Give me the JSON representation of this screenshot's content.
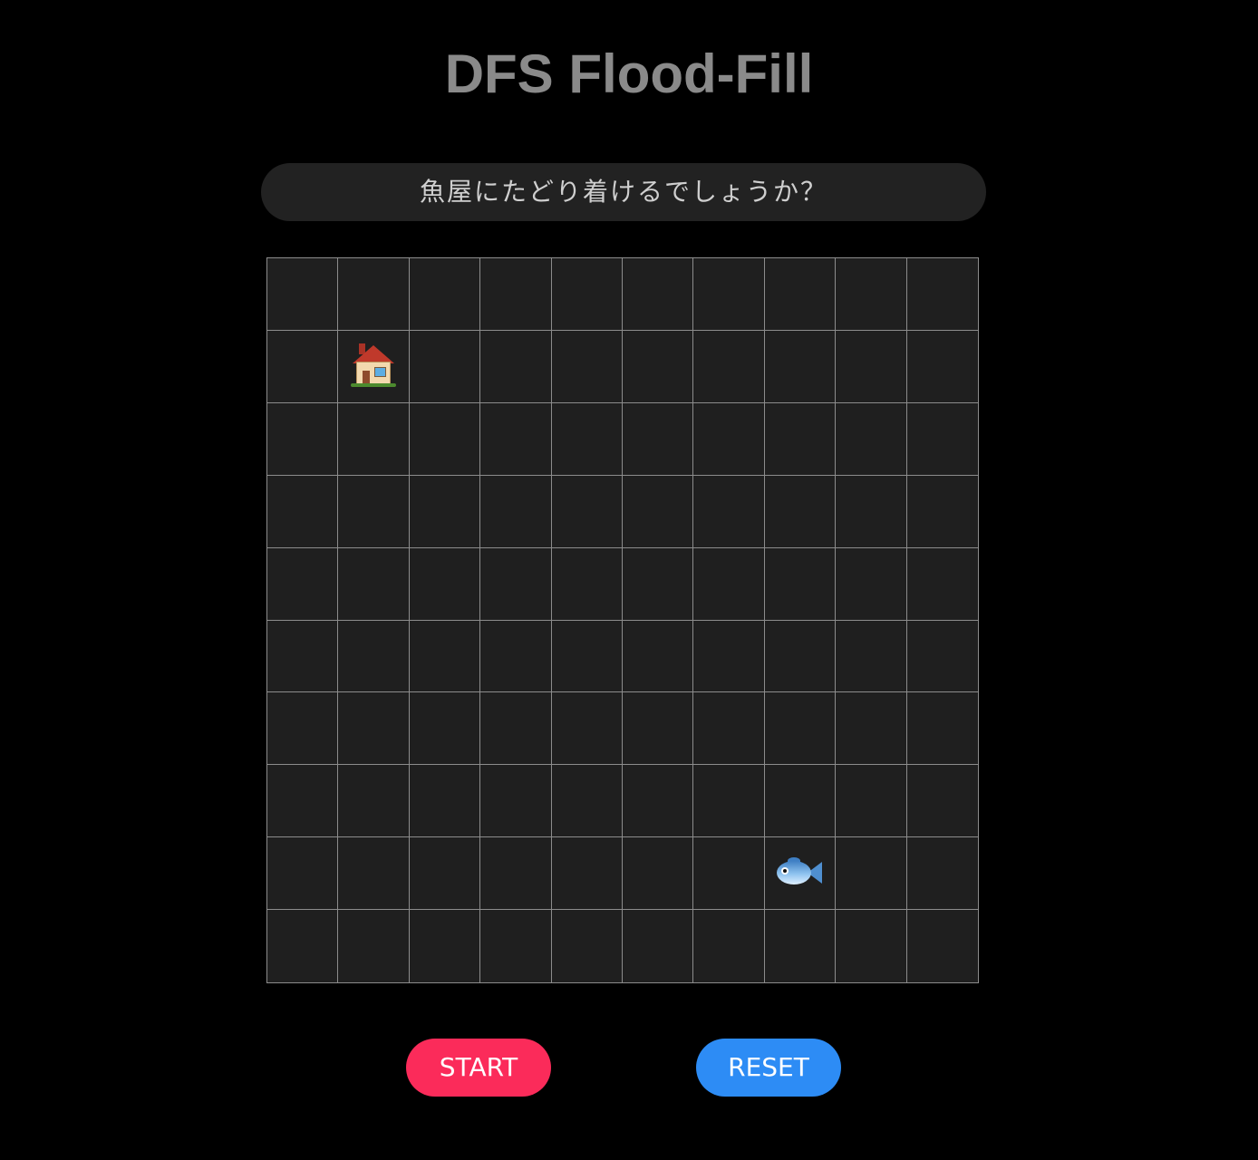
{
  "title": "DFS Flood-Fill",
  "message": "魚屋にたどり着けるでしょうか？",
  "grid": {
    "rows": 10,
    "cols": 10,
    "house": {
      "row": 1,
      "col": 1,
      "icon": "house-icon"
    },
    "fish": {
      "row": 8,
      "col": 7,
      "icon": "fish-icon"
    }
  },
  "buttons": {
    "start_label": "START",
    "reset_label": "RESET"
  },
  "colors": {
    "background": "#000000",
    "title": "#8a8a8a",
    "grid_cell": "#1f1f1f",
    "grid_line": "#8c8c8c",
    "message_bg": "#222222",
    "start_button": "#fb2b5a",
    "reset_button": "#2d8cf5"
  }
}
